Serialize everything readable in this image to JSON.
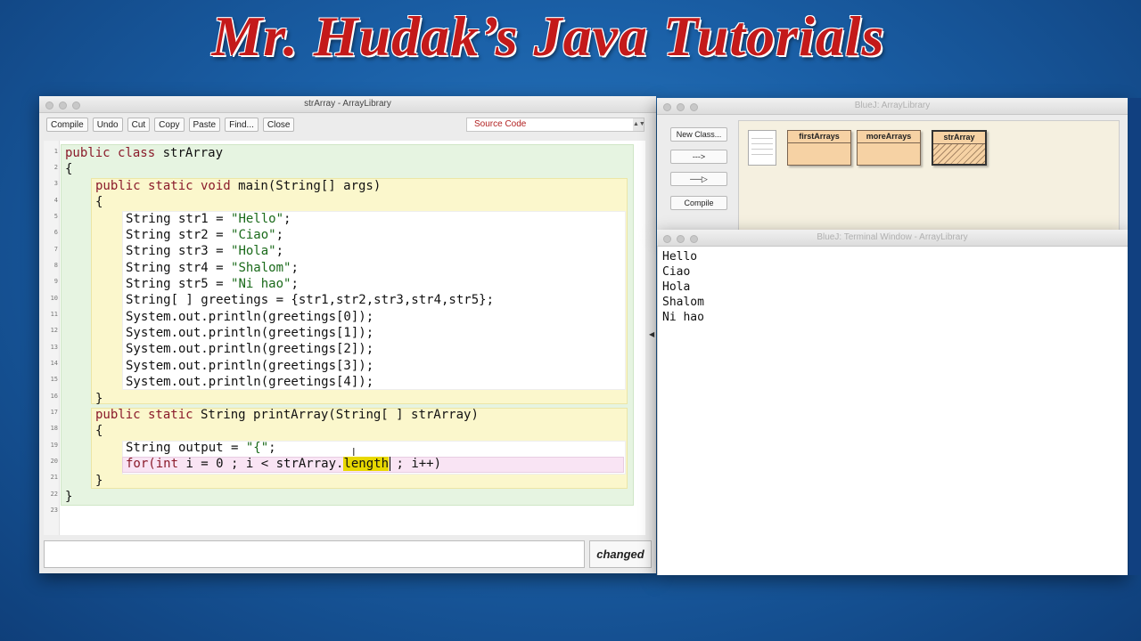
{
  "banner": {
    "title": "Mr. Hudak’s Java Tutorials"
  },
  "editor": {
    "window_title": "strArray - ArrayLibrary",
    "toolbar": [
      "Compile",
      "Undo",
      "Cut",
      "Copy",
      "Paste",
      "Find...",
      "Close"
    ],
    "view_select": "Source Code",
    "status": "changed",
    "line_numbers": [
      "1",
      "2",
      "3",
      "4",
      "5",
      "6",
      "7",
      "8",
      "9",
      "10",
      "11",
      "12",
      "13",
      "14",
      "15",
      "16",
      "17",
      "18",
      "19",
      "20",
      "21",
      "22",
      "23"
    ],
    "code": {
      "l1_kw": "public class",
      "l1_rest": " strArray",
      "l2": "{",
      "l3_kw": "public static void",
      "l3_rest": " main(String[] args)",
      "l4": "{",
      "l5_a": "String str1 = ",
      "l5_s": "\"Hello\"",
      "l5_b": ";",
      "l6_a": "String str2 = ",
      "l6_s": "\"Ciao\"",
      "l6_b": ";",
      "l7_a": "String str3 = ",
      "l7_s": "\"Hola\"",
      "l7_b": ";",
      "l8_a": "String str4 = ",
      "l8_s": "\"Shalom\"",
      "l8_b": ";",
      "l9_a": "String str5 = ",
      "l9_s": "\"Ni hao\"",
      "l9_b": ";",
      "l10": "String[ ] greetings = {str1,str2,str3,str4,str5};",
      "l11": "System.out.println(greetings[0]);",
      "l12": "System.out.println(greetings[1]);",
      "l13": "System.out.println(greetings[2]);",
      "l14": "System.out.println(greetings[3]);",
      "l15": "System.out.println(greetings[4]);",
      "l16": "}",
      "l17_kw": "public static",
      "l17_rest": " String printArray(String[ ] strArray)",
      "l18": "{",
      "l19_a": "String output = ",
      "l19_s": "\"{\"",
      "l19_b": ";",
      "l20_kw": "for(int",
      "l20_a": " i = 0 ; i < strArray.",
      "l20_hl": "length",
      "l20_b": " ; i++)",
      "l21": "}",
      "l22": "}"
    }
  },
  "bluej": {
    "window_title": "BlueJ:  ArrayLibrary",
    "buttons": {
      "new_class": "New Class...",
      "dep_arrow": "--->",
      "inh_arrow": "──▷",
      "compile": "Compile"
    },
    "classes": [
      "firstArrays",
      "moreArrays",
      "strArray"
    ]
  },
  "terminal": {
    "window_title": "BlueJ: Terminal Window - ArrayLibrary",
    "lines": [
      "Hello",
      "Ciao",
      "Hola",
      "Shalom",
      "Ni hao"
    ]
  },
  "colors": {
    "keyword": "#8a1a2a",
    "string": "#1a6a1a",
    "class_scope": "#e6f4e1",
    "method_scope": "#fbf7cc",
    "loop_scope": "#f9e4f4",
    "highlight": "#e8d800"
  }
}
